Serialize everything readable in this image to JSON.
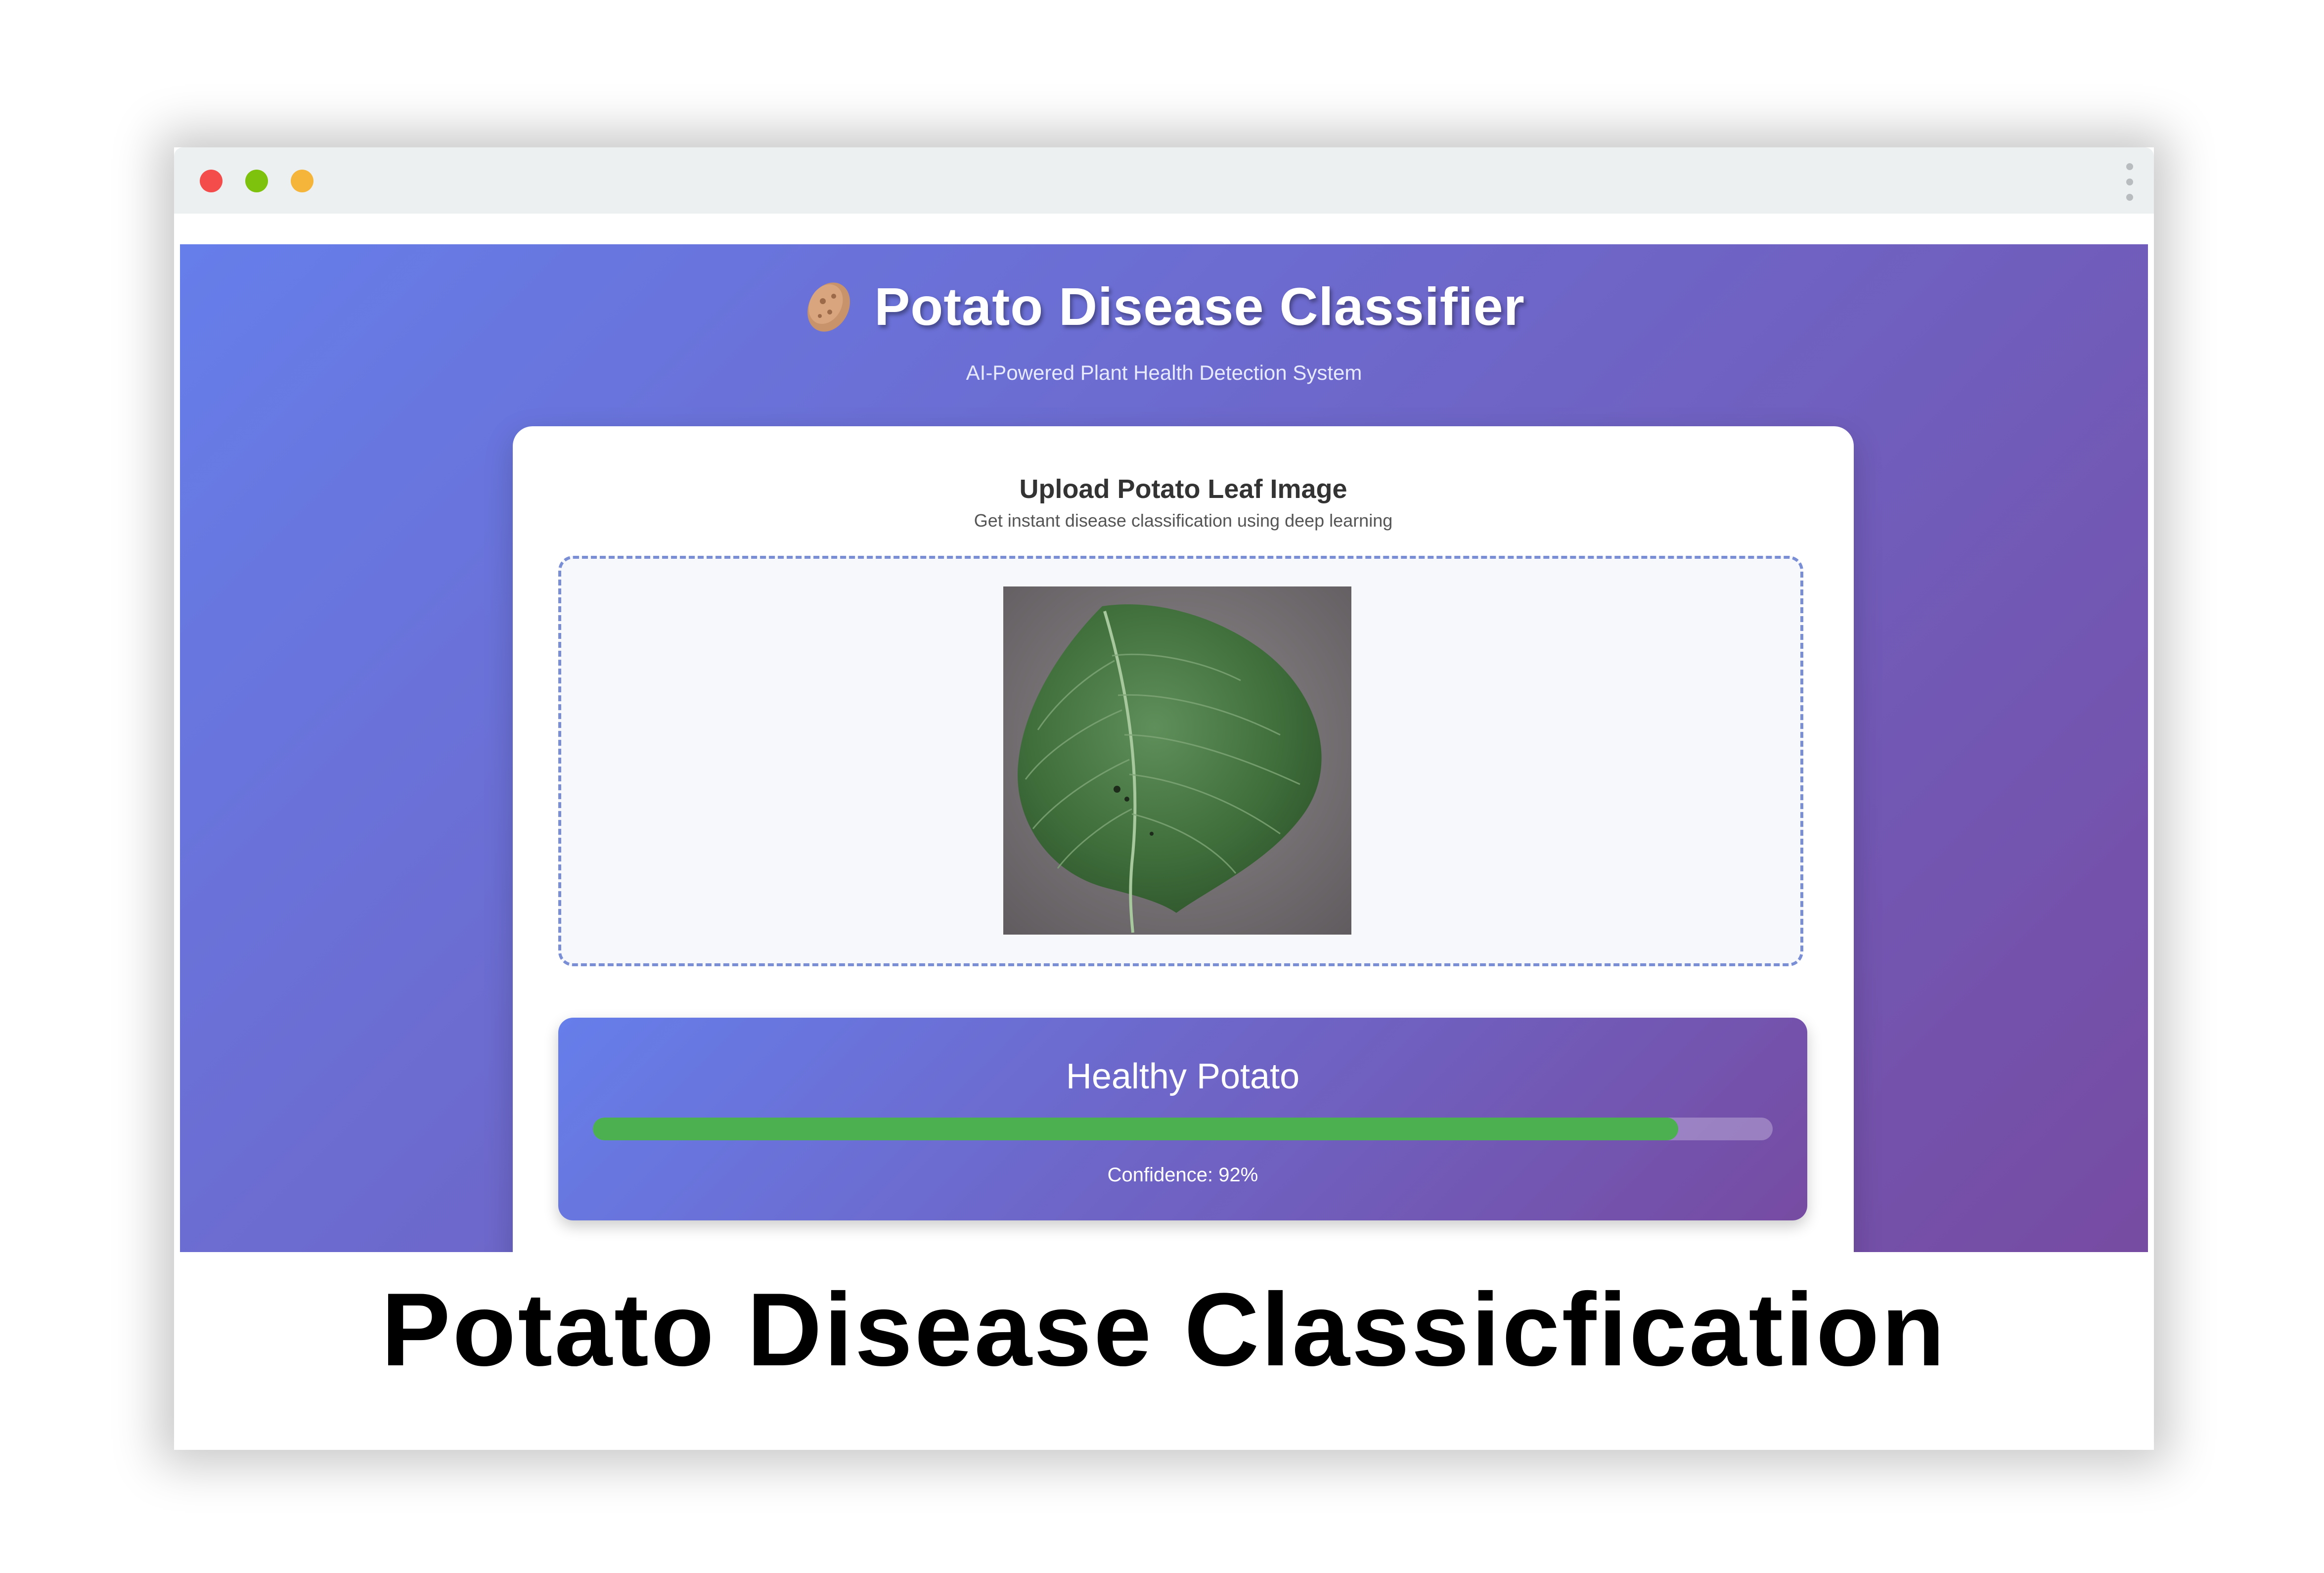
{
  "app": {
    "title": "Potato Disease Classifier",
    "subtitle": "AI-Powered Plant Health Detection System",
    "icon": "potato-icon"
  },
  "upload": {
    "title": "Upload Potato Leaf Image",
    "subtitle": "Get instant disease classification using deep learning"
  },
  "result": {
    "label": "Healthy Potato",
    "confidence_text": "Confidence: 92%",
    "confidence_value": 0.92
  },
  "caption": "Potato Disease Classicfication",
  "colors": {
    "gradient_start": "#667eea",
    "gradient_end": "#764ba2",
    "confidence_bar": "#4caf50"
  }
}
